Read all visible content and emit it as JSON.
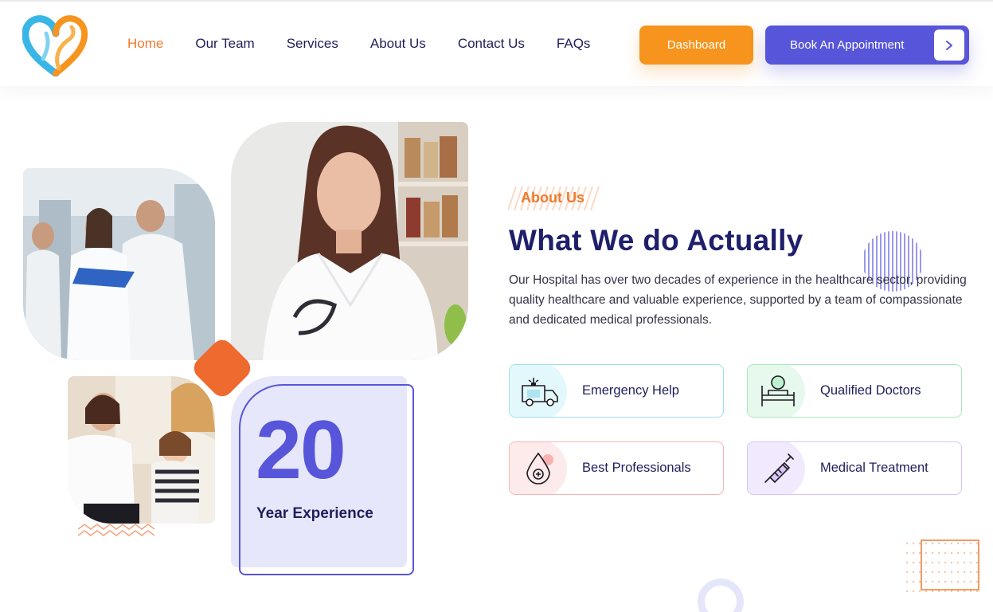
{
  "nav": {
    "items": [
      {
        "label": "Home",
        "active": true
      },
      {
        "label": "Our Team",
        "active": false
      },
      {
        "label": "Services",
        "active": false
      },
      {
        "label": "About Us",
        "active": false
      },
      {
        "label": "Contact Us",
        "active": false
      },
      {
        "label": "FAQs",
        "active": false
      }
    ],
    "dashboard_label": "Dashboard",
    "book_label": "Book An Appointment"
  },
  "experience": {
    "number": "20",
    "label": "Year Experience"
  },
  "about": {
    "tag": "About Us",
    "title": "What We do Actually",
    "description": "Our Hospital has over two decades of experience in the healthcare sector, providing quality healthcare and valuable experience, supported by a team of compassionate and dedicated medical professionals."
  },
  "features": [
    {
      "label": "Emergency Help",
      "icon": "ambulance-icon"
    },
    {
      "label": "Qualified Doctors",
      "icon": "patient-bed-icon"
    },
    {
      "label": "Best Professionals",
      "icon": "blood-drop-icon"
    },
    {
      "label": "Medical Treatment",
      "icon": "syringe-icon"
    }
  ],
  "colors": {
    "primary": "#5755d9",
    "accent": "#f7941d",
    "heading": "#1f1f6b",
    "tag": "#f07a2d"
  }
}
